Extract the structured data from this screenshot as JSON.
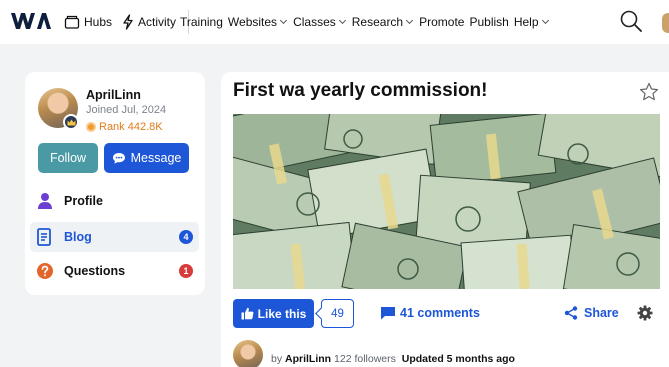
{
  "nav": {
    "hubs": "Hubs",
    "activity": "Activity",
    "links": [
      {
        "label": "Training",
        "has_menu": false
      },
      {
        "label": "Websites",
        "has_menu": true
      },
      {
        "label": "Classes",
        "has_menu": true
      },
      {
        "label": "Research",
        "has_menu": true
      },
      {
        "label": "Promote",
        "has_menu": false
      },
      {
        "label": "Publish",
        "has_menu": false
      },
      {
        "label": "Help",
        "has_menu": true
      }
    ],
    "icons": [
      "wa-logo-icon",
      "hubs-icon",
      "activity-icon",
      "search-icon"
    ]
  },
  "profile": {
    "name": "AprilLinn",
    "joined": "Joined Jul, 2024",
    "rank": "Rank 442.8K",
    "follow_label": "Follow",
    "message_label": "Message",
    "menu": [
      {
        "label": "Profile",
        "icon": "person-icon",
        "count": null
      },
      {
        "label": "Blog",
        "icon": "blog-icon",
        "count": "4",
        "active": true
      },
      {
        "label": "Questions",
        "icon": "question-icon",
        "count": "1"
      }
    ]
  },
  "post": {
    "title": "First wa yearly commission!",
    "like_label": "Like this",
    "like_count": "49",
    "comments_label": "41 comments",
    "share_label": "Share",
    "byline_prefix": "by",
    "author": "AprilLinn",
    "followers": "122 followers",
    "updated": "Updated 5 months ago"
  },
  "colors": {
    "primary": "#1d56d6",
    "follow": "#4a9aa6",
    "rank": "#e07b1a",
    "badge_blue": "#1d56d6",
    "badge_red": "#d83b3b",
    "question": "#e2662a",
    "profile_icon": "#6b3fd1"
  }
}
